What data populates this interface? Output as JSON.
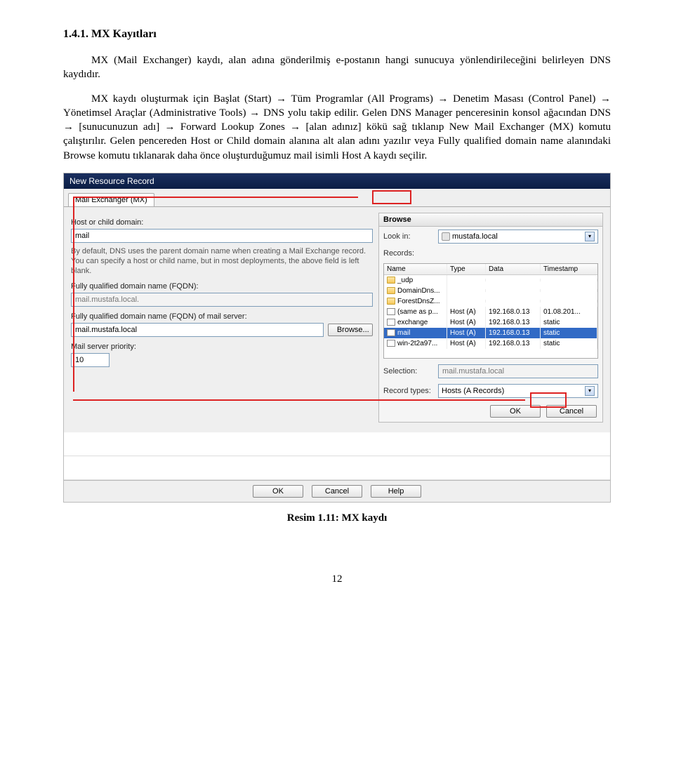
{
  "heading": "1.4.1. MX  Kayıtları",
  "para1": "MX (Mail Exchanger) kaydı, alan adına gönderilmiş e-postanın hangi sunucuya yönlendirileceğini belirleyen DNS kaydıdır.",
  "para2": "MX kaydı oluşturmak için Başlat (Start) → Tüm Programlar (All Programs) → Denetim Masası (Control Panel) → Yönetimsel Araçlar (Administrative Tools) → DNS yolu takip edilir. Gelen DNS Manager penceresinin konsol ağacından DNS → [sunucunuzun adı] → Forward Lookup Zones → [alan adınız] kökü sağ tıklanıp New Mail Exchanger (MX) komutu çalıştırılır. Gelen pencereden Host or Child domain alanına alt alan adını yazılır veya Fully qualified domain name alanındaki Browse komutu tıklanarak daha önce oluşturduğumuz mail isimli Host A kaydı seçilir.",
  "dialog": {
    "title": "New Resource Record",
    "tab_label": "Mail Exchanger (MX)",
    "host_label": "Host or child domain:",
    "host_value": "mail",
    "desc": "By default, DNS uses the parent domain name when creating a Mail Exchange record. You can specify a host or child name, but in most deployments, the above field is left blank.",
    "fqdn_label": "Fully qualified domain name (FQDN):",
    "fqdn_value": "mail.mustafa.local.",
    "fqdn_server_label": "Fully qualified domain name (FQDN) of mail server:",
    "fqdn_server_value": "mail.mustafa.local",
    "browse_btn": "Browse...",
    "priority_label": "Mail server priority:",
    "priority_value": "10",
    "ok": "OK",
    "cancel": "Cancel",
    "help": "Help"
  },
  "browse": {
    "title": "Browse",
    "lookin_label": "Look in:",
    "lookin_value": "mustafa.local",
    "records_label": "Records:",
    "columns": {
      "name": "Name",
      "type": "Type",
      "data": "Data",
      "ts": "Timestamp"
    },
    "rows": [
      {
        "name": "_udp",
        "type": "",
        "data": "",
        "ts": "",
        "icon": "folder"
      },
      {
        "name": "DomainDns...",
        "type": "",
        "data": "",
        "ts": "",
        "icon": "folder"
      },
      {
        "name": "ForestDnsZ...",
        "type": "",
        "data": "",
        "ts": "",
        "icon": "folder"
      },
      {
        "name": "(same as p...",
        "type": "Host (A)",
        "data": "192.168.0.13",
        "ts": "01.08.201...",
        "icon": "file"
      },
      {
        "name": "exchange",
        "type": "Host (A)",
        "data": "192.168.0.13",
        "ts": "static",
        "icon": "file"
      },
      {
        "name": "mail",
        "type": "Host (A)",
        "data": "192.168.0.13",
        "ts": "static",
        "icon": "file",
        "selected": true
      },
      {
        "name": "win-2t2a97...",
        "type": "Host (A)",
        "data": "192.168.0.13",
        "ts": "static",
        "icon": "file"
      }
    ],
    "selection_label": "Selection:",
    "selection_value": "mail.mustafa.local",
    "rectypes_label": "Record types:",
    "rectypes_value": "Hosts (A Records)",
    "ok": "OK",
    "cancel": "Cancel"
  },
  "caption": "Resim 1.11: MX kaydı",
  "page_number": "12"
}
